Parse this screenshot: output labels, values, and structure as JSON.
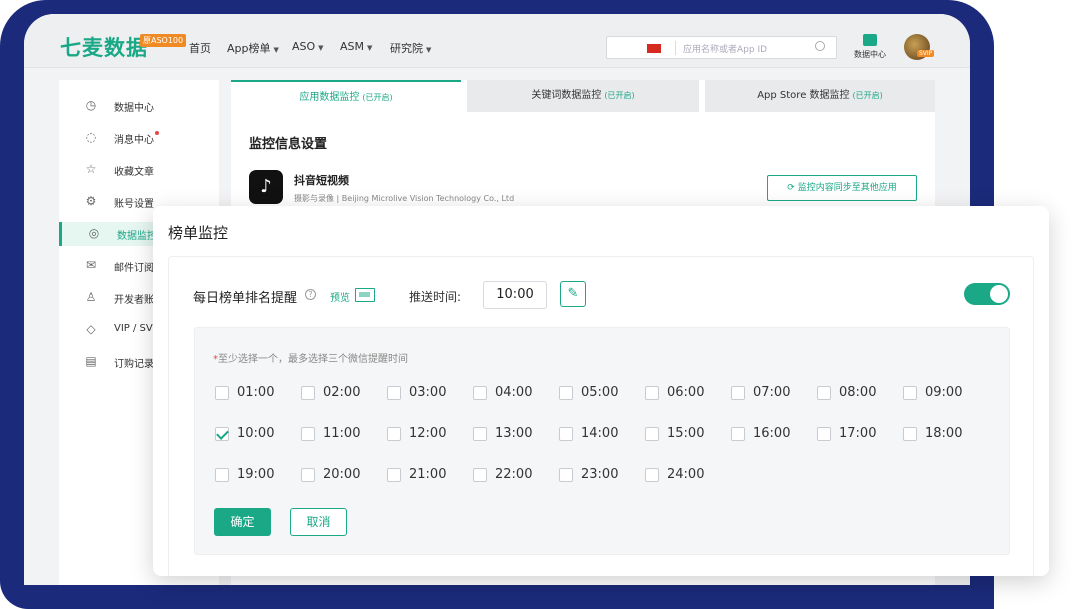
{
  "brand": {
    "logo_text": "七麦数据",
    "badge": "原ASO100",
    "accent": "#1aa886"
  },
  "nav": {
    "items": [
      {
        "label": "首页",
        "dropdown": false
      },
      {
        "label": "App榜单",
        "dropdown": true
      },
      {
        "label": "ASO",
        "dropdown": true
      },
      {
        "label": "ASM",
        "dropdown": true
      },
      {
        "label": "研究院",
        "dropdown": true
      }
    ],
    "search_placeholder": "应用名称或者App ID",
    "data_center_label": "数据中心",
    "avatar_badge": "SVIP"
  },
  "sidebar": {
    "items": [
      {
        "label": "数据中心",
        "icon": "clock-icon"
      },
      {
        "label": "消息中心",
        "icon": "message-icon",
        "has_dot": true
      },
      {
        "label": "收藏文章",
        "icon": "star-icon"
      },
      {
        "label": "账号设置",
        "icon": "gear-icon"
      },
      {
        "label": "数据监控",
        "icon": "monitor-icon",
        "active": true
      },
      {
        "label": "邮件订阅",
        "icon": "mail-icon"
      },
      {
        "label": "开发者账号",
        "icon": "user-icon"
      },
      {
        "label": "VIP / SVIP",
        "icon": "vip-icon"
      },
      {
        "label": "订购记录",
        "icon": "receipt-icon"
      }
    ]
  },
  "tabs": [
    {
      "label": "应用数据监控",
      "status": "(已开启)",
      "active": true
    },
    {
      "label": "关键词数据监控",
      "status": "(已开启)",
      "active": false
    },
    {
      "label": "App Store 数据监控",
      "status": "(已开启)",
      "active": false
    }
  ],
  "monitor": {
    "section_title": "监控信息设置",
    "app_name": "抖音短视频",
    "app_category": "摄影与录像",
    "app_developer": "Beijing Microlive Vision Technology Co., Ltd",
    "sync_button": "监控内容同步至其他应用"
  },
  "modal": {
    "title": "榜单监控",
    "remind_label": "每日榜单排名提醒",
    "preview_label": "预览",
    "push_time_label": "推送时间:",
    "push_time_value": "10:00",
    "toggle_on": true,
    "hint": "至少选择一个，最多选择三个微信提醒时间",
    "times": [
      {
        "label": "01:00",
        "checked": false
      },
      {
        "label": "02:00",
        "checked": false
      },
      {
        "label": "03:00",
        "checked": false
      },
      {
        "label": "04:00",
        "checked": false
      },
      {
        "label": "05:00",
        "checked": false
      },
      {
        "label": "06:00",
        "checked": false
      },
      {
        "label": "07:00",
        "checked": false
      },
      {
        "label": "08:00",
        "checked": false
      },
      {
        "label": "09:00",
        "checked": false
      },
      {
        "label": "10:00",
        "checked": true
      },
      {
        "label": "11:00",
        "checked": false
      },
      {
        "label": "12:00",
        "checked": false
      },
      {
        "label": "13:00",
        "checked": false
      },
      {
        "label": "14:00",
        "checked": false
      },
      {
        "label": "15:00",
        "checked": false
      },
      {
        "label": "16:00",
        "checked": false
      },
      {
        "label": "17:00",
        "checked": false
      },
      {
        "label": "18:00",
        "checked": false
      },
      {
        "label": "19:00",
        "checked": false
      },
      {
        "label": "20:00",
        "checked": false
      },
      {
        "label": "21:00",
        "checked": false
      },
      {
        "label": "22:00",
        "checked": false
      },
      {
        "label": "23:00",
        "checked": false
      },
      {
        "label": "24:00",
        "checked": false
      }
    ],
    "confirm_label": "确定",
    "cancel_label": "取消"
  }
}
